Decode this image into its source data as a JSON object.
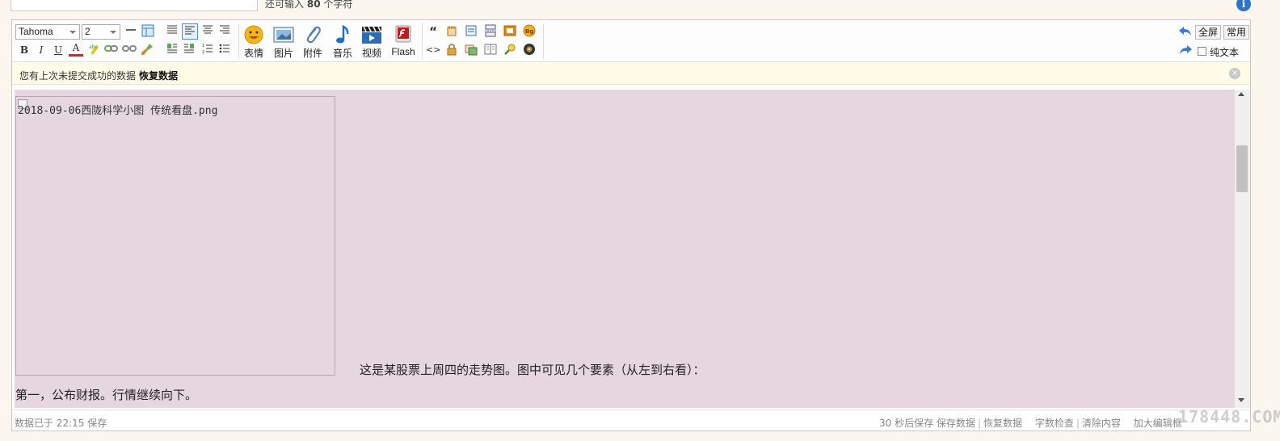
{
  "top": {
    "remaining_prefix": "还可输入",
    "remaining_count": "80",
    "remaining_suffix": "个字符",
    "info_icon": "i"
  },
  "toolbar": {
    "font_name": "Tahoma",
    "font_size": "2",
    "format_buttons": [
      "B",
      "I",
      "U",
      "A"
    ],
    "big_buttons": [
      {
        "icon": "smiley-icon",
        "label": "表情"
      },
      {
        "icon": "image-icon",
        "label": "图片"
      },
      {
        "icon": "paperclip-icon",
        "label": "附件"
      },
      {
        "icon": "music-note-icon",
        "label": "音乐"
      },
      {
        "icon": "film-icon",
        "label": "视频"
      },
      {
        "icon": "flash-icon",
        "label": "Flash"
      }
    ],
    "quote_glyph": "“",
    "code_glyph": "<>",
    "bg_badge": "Bg",
    "fullscreen_label": "全屏",
    "common_label": "常用",
    "plaintext_label": "纯文本"
  },
  "recover": {
    "message": "您有上次未提交成功的数据",
    "link": "恢复数据",
    "close_icon": "×"
  },
  "content": {
    "image_alt": "2018-09-06西陇科学小图 传统看盘.png",
    "paragraph1": "这是某股票上周四的走势图。图中可见几个要素（从左到右看）：",
    "paragraph2": "第一，公布财报。行情继续向下。"
  },
  "status": {
    "saved_text": "数据已于 22:15 保存",
    "autosave": "30 秒后保存",
    "save_data": "保存数据",
    "restore_data": "恢复数据",
    "word_check": "字数检查",
    "clear_content": "清除内容",
    "enlarge_editor": "加大编辑框"
  },
  "watermark": "178448.COM",
  "colors": {
    "content_bg": "#e6d6e0",
    "recover_bg": "#fffbe6",
    "page_bg": "#fbf6ee",
    "info_blue": "#2c74c8"
  }
}
